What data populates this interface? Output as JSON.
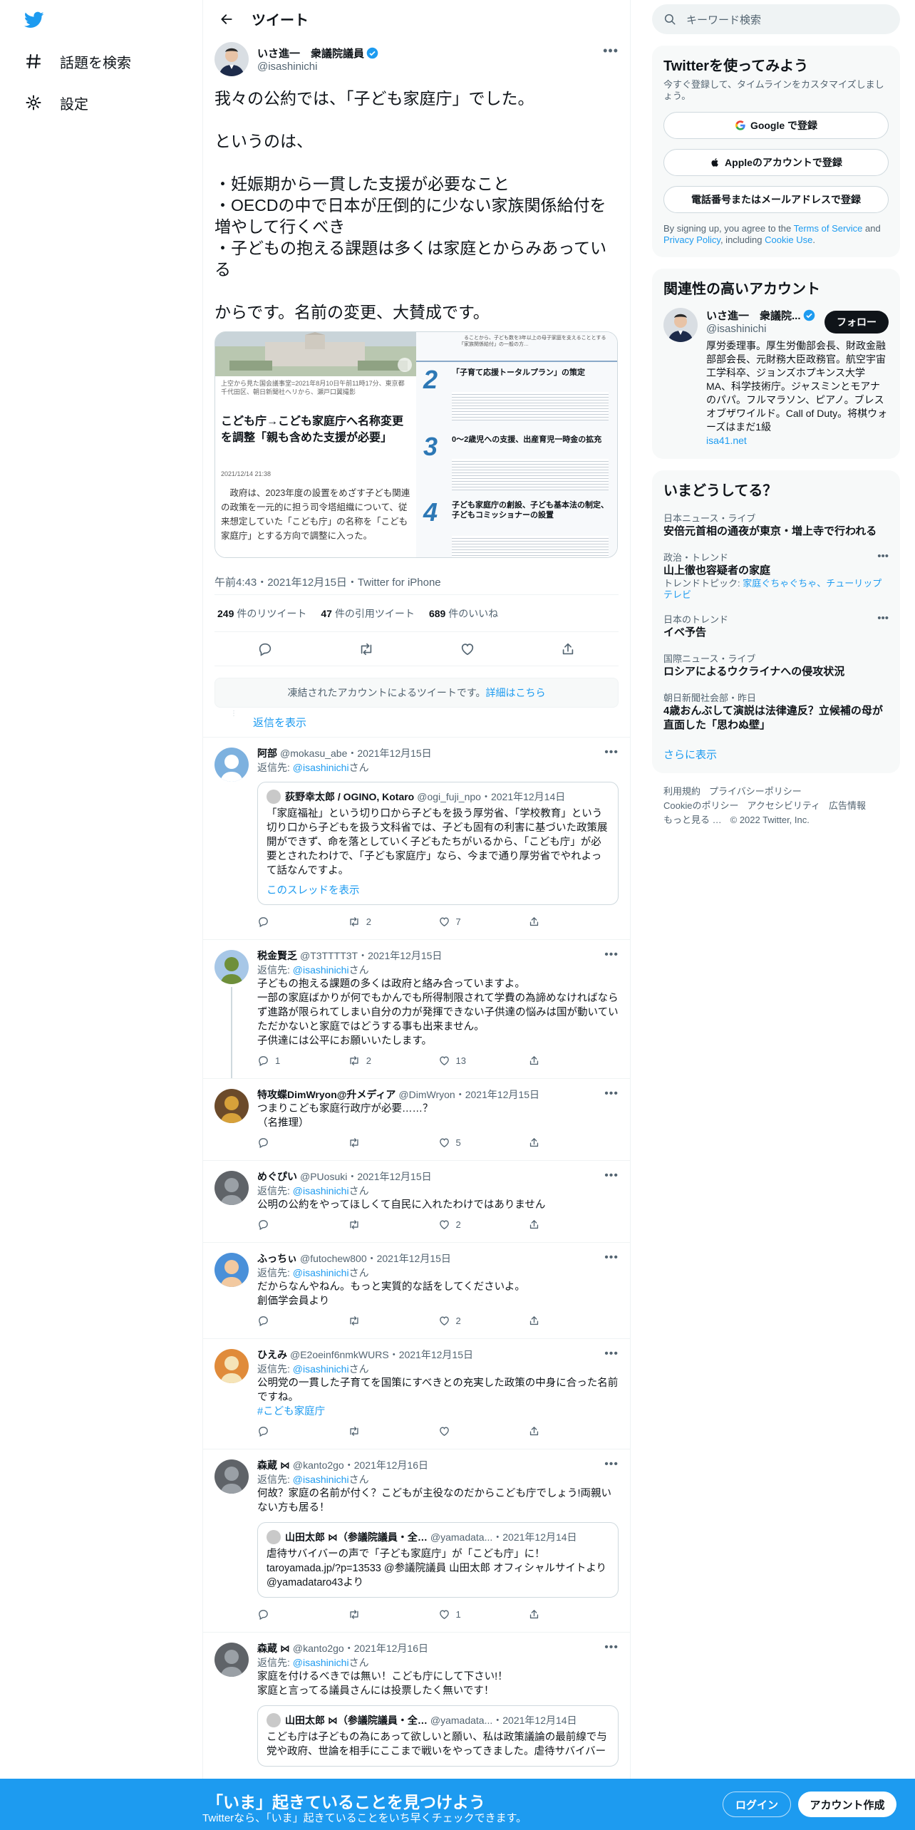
{
  "nav": {
    "explore_label": "話題を検索",
    "settings_label": "設定"
  },
  "header": {
    "title": "ツイート"
  },
  "tweet": {
    "author_name": "いさ進一　衆議院議員",
    "author_handle": "@isashinichi",
    "text": "我々の公約では、「子ども家庭庁」でした。\n\nというのは、\n\n・妊娠期から一貫した支援が必要なこと\n・OECDの中で日本が圧倒的に少ない家族関係給付を増やして行くべき\n・子どもの抱える課題は多くは家庭とからみあっている\n\nからです。名前の変更、大賛成です。",
    "media_left": {
      "caption": "上空から見た国会議事堂=2021年8月10日午前11時17分、東京都千代田区、朝日新聞社ヘリから、瀬戸口翼撮影",
      "headline": "こども庁→こども家庭庁へ名称変更を調整「親も含めた支援が必要」",
      "date": "2021/12/14 21:38",
      "body": "　政府は、2023年度の設置をめざす子ども関連の政策を一元的に担う司令塔組織について、従来想定していた「こども庁」の名称を「こども家庭庁」とする方向で調整に入った。"
    },
    "media_right": {
      "top_text": "　ることから、子ども数を3年以上の母子家庭を支えることとする「家族関係給付」の一般の方…",
      "items": [
        {
          "num": "2",
          "title": "「子育て応援トータルプラン」の策定"
        },
        {
          "num": "3",
          "title": "0～2歳児への支援、出産育児一時金の拡充"
        },
        {
          "num": "4",
          "title": "子ども家庭庁の創設、子ども基本法の制定、子どもコミッショナーの設置"
        }
      ]
    },
    "timestamp": "午前4:43・2021年12月15日・Twitter for iPhone",
    "retweets": "249",
    "retweets_label": "件のリツイート",
    "quotes": "47",
    "quotes_label": "件の引用ツイート",
    "likes": "689",
    "likes_label": "件のいいね"
  },
  "notice": {
    "text": "凍結されたアカウントによるツイートです。",
    "link": "詳細はこちら"
  },
  "show_replies": "返信を表示",
  "replies": [
    {
      "name": "阿部",
      "handle": "@mokasu_abe",
      "date": "2021年12月15日",
      "reply_to_prefix": "返信先: ",
      "reply_to": "@isashinichi",
      "reply_to_suffix": "さん",
      "text": "",
      "quote": {
        "name": "荻野幸太郎 / OGINO, Kotaro",
        "handle": "@ogi_fuji_npo",
        "date": "2021年12月14日",
        "text": "「家庭福祉」という切り口から子どもを扱う厚労省、「学校教育」という切り口から子どもを扱う文科省では、子ども固有の利害に基づいた政策展開ができず、命を落としていく子どもたちがいるから、「こども庁」が必要とされたわけで、「子ども家庭庁」なら、今まで通り厚労省でやれよって話なんですよ。",
        "link": "このスレッドを表示"
      },
      "replies_count": "",
      "retweets_count": "2",
      "likes_count": "7"
    },
    {
      "name": "税金賢乏",
      "handle": "@T3TTTT3T",
      "date": "2021年12月15日",
      "reply_to_prefix": "返信先: ",
      "reply_to": "@isashinichi",
      "reply_to_suffix": "さん",
      "text": "子どもの抱える課題の多くは政府と絡み合っていますよ。\n一部の家庭ばかりが何でもかんでも所得制限されて学費の為諦めなければならず進路が限られてしまい自分の力が発揮できない子供達の悩みは国が動いていただかないと家庭ではどうする事も出来ません。\n子供達には公平にお願いいたします。",
      "replies_count": "1",
      "retweets_count": "2",
      "likes_count": "13"
    },
    {
      "name": "特攻蝶DimWryon@升メディア",
      "handle": "@DimWryon",
      "date": "2021年12月15日",
      "reply_to_prefix": "",
      "reply_to": "",
      "reply_to_suffix": "",
      "text": "つまりこども家庭行政庁が必要……？\n（名推理）",
      "replies_count": "",
      "retweets_count": "",
      "likes_count": "5"
    },
    {
      "name": "めぐぴい",
      "handle": "@PUosuki",
      "date": "2021年12月15日",
      "reply_to_prefix": "返信先: ",
      "reply_to": "@isashinichi",
      "reply_to_suffix": "さん",
      "text": "公明の公約をやってほしくて自民に入れたわけではありません",
      "replies_count": "",
      "retweets_count": "",
      "likes_count": "2"
    },
    {
      "name": "ふっちぃ",
      "handle": "@futochew800",
      "date": "2021年12月15日",
      "reply_to_prefix": "返信先: ",
      "reply_to": "@isashinichi",
      "reply_to_suffix": "さん",
      "text": "だからなんやねん。もっと実質的な話をしてくださいよ。\n創価学会員より",
      "replies_count": "",
      "retweets_count": "",
      "likes_count": "2"
    },
    {
      "name": "ひえみ",
      "handle": "@E2oeinf6nmkWURS",
      "date": "2021年12月15日",
      "reply_to_prefix": "返信先: ",
      "reply_to": "@isashinichi",
      "reply_to_suffix": "さん",
      "text": "公明党の一貫した子育てを国策にすべきとの充実した政策の中身に合った名前ですね。",
      "hashtag": "#こども家庭庁",
      "replies_count": "",
      "retweets_count": "",
      "likes_count": ""
    },
    {
      "name": "森蔵 ⋈",
      "handle": "@kanto2go",
      "date": "2021年12月16日",
      "reply_to_prefix": "返信先: ",
      "reply_to": "@isashinichi",
      "reply_to_suffix": "さん",
      "text": "何故？家庭の名前が付く？こどもが主役なのだからこども庁でしょう!両親いない方も居る！",
      "quote": {
        "name": "山田太郎 ⋈（参議院議員・全…",
        "handle": "@yamadata...",
        "date": "2021年12月14日",
        "text": "虐待サバイバーの声で「子ども家庭庁」が「こども庁」に！\ntaroyamada.jp/?p=13533 @参議院議員 山田太郎 オフィシャルサイトより@yamadataro43より",
        "link": ""
      },
      "replies_count": "",
      "retweets_count": "",
      "likes_count": "1"
    },
    {
      "name": "森蔵 ⋈",
      "handle": "@kanto2go",
      "date": "2021年12月16日",
      "reply_to_prefix": "返信先: ",
      "reply_to": "@isashinichi",
      "reply_to_suffix": "さん",
      "text": "家庭を付けるべきでは無い！こども庁にして下さい!！\n家庭と言ってる議員さんには投票したく無いです！",
      "quote": {
        "name": "山田太郎 ⋈（参議院議員・全…",
        "handle": "@yamadata...",
        "date": "2021年12月14日",
        "text": "こども庁は子どもの為にあって欲しいと願い、私は政策議論の最前線で与党や政府、世論を相手にここまで戦いをやってきました。虐待サバイバー",
        "link": ""
      },
      "replies_count": "",
      "retweets_count": "",
      "likes_count": ""
    }
  ],
  "right": {
    "search_placeholder": "キーワード検索",
    "signup": {
      "title": "Twitterを使ってみよう",
      "subtitle": "今すぐ登録して、タイムラインをカスタマイズしましょう。",
      "google": "Google で登録",
      "apple": "Appleのアカウントで登録",
      "phone": "電話番号またはメールアドレスで登録",
      "terms_1": "By signing up, you agree to the ",
      "terms_link1": "Terms of Service",
      "terms_2": " and ",
      "terms_link2": "Privacy Policy",
      "terms_3": ", including ",
      "terms_link3": "Cookie Use",
      "terms_4": "."
    },
    "related": {
      "title": "関連性の高いアカウント",
      "name": "いさ進一　衆議院...",
      "handle": "@isashinichi",
      "follow": "フォロー",
      "bio": "厚労委理事。厚生労働部会長、財政金融部部会長、元財務大臣政務官。航空宇宙工学科卒、ジョンズホプキンス大学MA、科学技術庁。ジャスミンとモアナのパパ。フルマラソン、ピアノ。ブレスオブザワイルド。Call of Duty。将棋ウォーズはまだ1級",
      "link": "isa41.net"
    },
    "trends": {
      "title": "いまどうしてる？",
      "items": [
        {
          "cat": "日本ニュース・ライブ",
          "title": "安倍元首相の通夜が東京・増上寺で行われる",
          "sub": "",
          "sub_links": ""
        },
        {
          "cat": "政治・トレンド",
          "title": "山上徹也容疑者の家庭",
          "sub": "トレンドトピック: ",
          "sub_links": "家庭ぐちゃぐちゃ、チューリップテレビ"
        },
        {
          "cat": "日本のトレンド",
          "title": "イベ予告",
          "sub": "",
          "sub_links": ""
        },
        {
          "cat": "国際ニュース・ライブ",
          "title": "ロシアによるウクライナへの侵攻状況",
          "sub": "",
          "sub_links": ""
        },
        {
          "cat": "朝日新聞社会部・昨日",
          "title": "4歳おんぶして演説は法律違反？立候補の母が直面した「思わぬ壁」",
          "sub": "",
          "sub_links": ""
        }
      ],
      "more": "さらに表示"
    },
    "footer": {
      "links": [
        "利用規約",
        "プライバシーポリシー",
        "Cookieのポリシー",
        "アクセシビリティ",
        "広告情報",
        "もっと見る …",
        "© 2022 Twitter, Inc."
      ]
    }
  },
  "bottom": {
    "title": "「いま」起きていることを見つけよう",
    "subtitle": "Twitterなら、「いま」起きていることをいち早くチェックできます。",
    "login": "ログイン",
    "signup": "アカウント作成"
  },
  "colors": {
    "accent": "#1d9bf0",
    "text": "#0f1419",
    "secondary": "#536471"
  }
}
